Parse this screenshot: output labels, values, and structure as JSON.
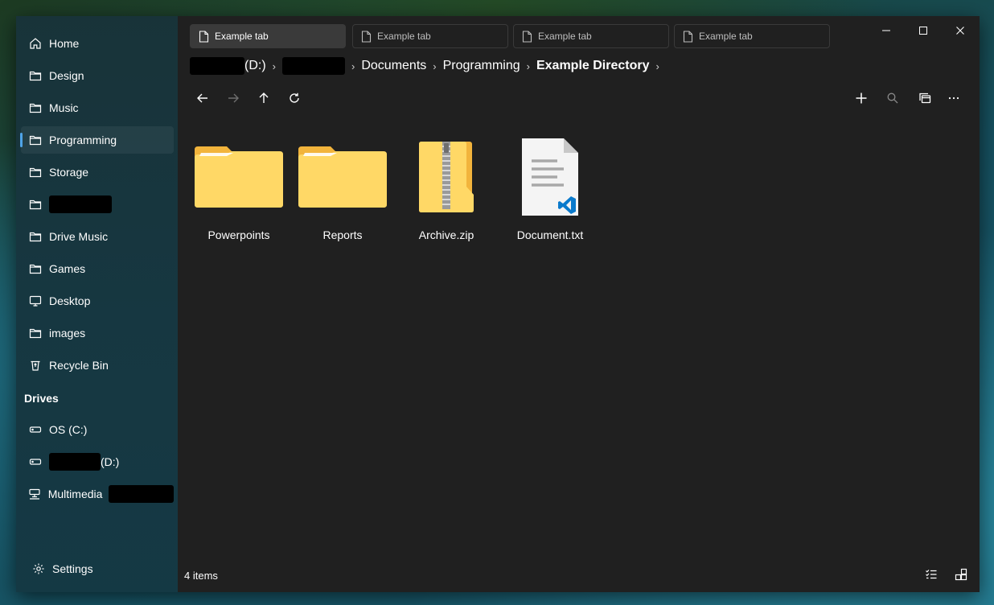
{
  "sidebar": {
    "items": [
      {
        "label": "Home",
        "icon": "home-icon"
      },
      {
        "label": "Design",
        "icon": "folder-icon"
      },
      {
        "label": "Music",
        "icon": "folder-icon"
      },
      {
        "label": "Programming",
        "icon": "folder-icon",
        "selected": true
      },
      {
        "label": "Storage",
        "icon": "folder-icon"
      },
      {
        "label": "",
        "icon": "folder-icon",
        "redacted": true
      },
      {
        "label": "Drive Music",
        "icon": "folder-icon"
      },
      {
        "label": "Games",
        "icon": "folder-icon"
      },
      {
        "label": "Desktop",
        "icon": "desktop-icon"
      },
      {
        "label": "images",
        "icon": "folder-icon"
      },
      {
        "label": "Recycle Bin",
        "icon": "recycle-bin-icon"
      }
    ],
    "drives_header": "Drives",
    "drives": [
      {
        "label": "OS (C:)",
        "icon": "drive-icon"
      },
      {
        "label": "(D:)",
        "icon": "drive-icon"
      },
      {
        "label": "Multimedia",
        "icon": "network-drive-icon"
      }
    ],
    "settings_label": "Settings"
  },
  "tabs": [
    {
      "label": "Example tab",
      "active": true
    },
    {
      "label": "Example tab"
    },
    {
      "label": "Example tab"
    },
    {
      "label": "Example tab"
    }
  ],
  "breadcrumb": {
    "drive_suffix": "(D:)",
    "parts": [
      "Documents",
      "Programming"
    ],
    "current": "Example Directory"
  },
  "files": [
    {
      "name": "Powerpoints",
      "type": "folder-icon"
    },
    {
      "name": "Reports",
      "type": "folder-icon"
    },
    {
      "name": "Archive.zip",
      "type": "zip-folder-icon"
    },
    {
      "name": "Document.txt",
      "type": "text-document-icon"
    }
  ],
  "status": {
    "items_count": "4 items"
  },
  "colors": {
    "accent": "#4fa4e8",
    "window_bg": "#202020",
    "folder_yellow": "#ffd866",
    "vscode_blue": "#0a7acc"
  }
}
